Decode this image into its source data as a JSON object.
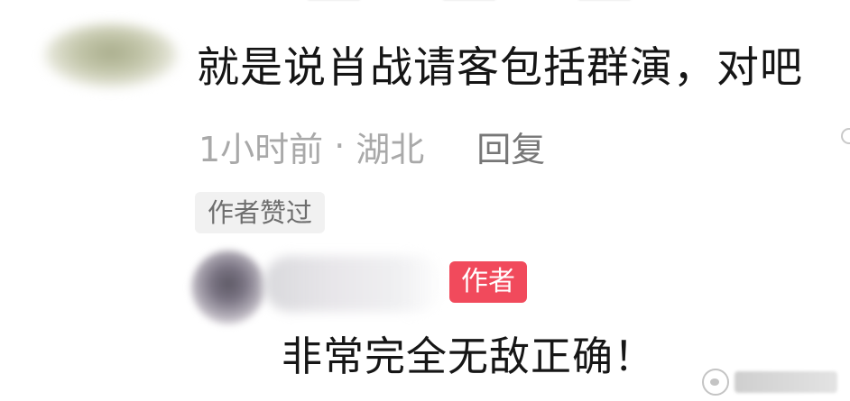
{
  "comment": {
    "text": "就是说肖战请客包括群演，对吧",
    "time": "1小时前",
    "separator": "·",
    "location": "湖北",
    "reply_label": "回复",
    "liked_badge": "作者赞过"
  },
  "reply": {
    "author_tag": "作者",
    "text": "非常完全无敌正确！"
  },
  "colors": {
    "author_tag_bg": "#f14a5c",
    "badge_bg": "#f1f1f1",
    "meta_text": "#a9a9a9",
    "body_text": "#151515"
  },
  "icons": {
    "watermark": "weibo-logo-icon"
  }
}
